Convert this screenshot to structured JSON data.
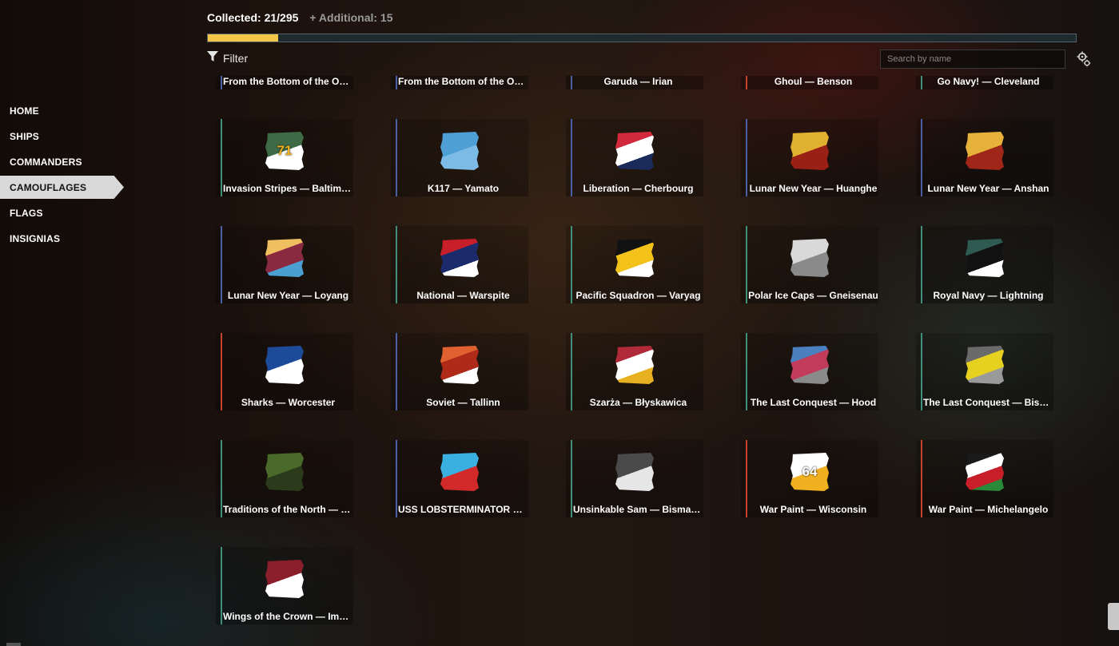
{
  "sidebar": {
    "items": [
      {
        "label": "HOME",
        "active": false
      },
      {
        "label": "SHIPS",
        "active": false
      },
      {
        "label": "COMMANDERS",
        "active": false
      },
      {
        "label": "CAMOUFLAGES",
        "active": true
      },
      {
        "label": "FLAGS",
        "active": false
      },
      {
        "label": "INSIGNIAS",
        "active": false
      }
    ]
  },
  "header": {
    "collected_label": "Collected: 21/295",
    "additional_label": "+ Additional: 15",
    "progress_fraction": 0.081
  },
  "filter": {
    "label": "Filter",
    "search_placeholder": "Search by name"
  },
  "colors": {
    "accent_yellow": "#f2c747",
    "accent_red": "#c8412c",
    "accent_blue": "#4a5fa6",
    "accent_teal": "#3f8f7a"
  },
  "grid": {
    "items": [
      {
        "label": "From the Bottom of the Ocea...",
        "accent": "#4a5fa6",
        "icon_colors": [
          "#1a2a44",
          "#2e5a88"
        ],
        "icon_text": ""
      },
      {
        "label": "From the Bottom of the Ocea...",
        "accent": "#4a5fa6",
        "icon_colors": [
          "#1a2a44",
          "#3c3c3c"
        ],
        "icon_text": ""
      },
      {
        "label": "Garuda — Irian",
        "accent": "#4a5fa6",
        "icon_colors": [
          "#7a1a2a",
          "#c23b3b"
        ],
        "icon_text": ""
      },
      {
        "label": "Ghoul — Benson",
        "accent": "#c8412c",
        "icon_colors": [
          "#5a1530",
          "#9b2a4a"
        ],
        "icon_text": ""
      },
      {
        "label": "Go Navy! — Cleveland",
        "accent": "#3f8f7a",
        "icon_colors": [
          "#1a2a6a",
          "#c2283a"
        ],
        "icon_text": ""
      },
      {
        "label": "Invasion Stripes — Baltimore",
        "accent": "#3f8f7a",
        "icon_colors": [
          "#3e6a45",
          "#ffffff"
        ],
        "icon_text": "71"
      },
      {
        "label": "K117 — Yamato",
        "accent": "#4a5fa6",
        "icon_colors": [
          "#4d9fd6",
          "#7cbbe6"
        ],
        "icon_text": ""
      },
      {
        "label": "Liberation — Cherbourg",
        "accent": "#4a5fa6",
        "icon_colors": [
          "#d22a3c",
          "#ffffff",
          "#1a2a5a"
        ],
        "icon_text": ""
      },
      {
        "label": "Lunar New Year — Huanghe",
        "accent": "#4a5fa6",
        "icon_colors": [
          "#e0b030",
          "#9a2016"
        ],
        "icon_text": ""
      },
      {
        "label": "Lunar New Year — Anshan",
        "accent": "#4a5fa6",
        "icon_colors": [
          "#e7b23a",
          "#a1261a"
        ],
        "icon_text": ""
      },
      {
        "label": "Lunar New Year — Loyang",
        "accent": "#4a5fa6",
        "icon_colors": [
          "#f0c060",
          "#8a2a40",
          "#4aa0d0"
        ],
        "icon_text": ""
      },
      {
        "label": "National — Warspite",
        "accent": "#3f8f7a",
        "icon_colors": [
          "#c81e2a",
          "#1a2a6a",
          "#ffffff"
        ],
        "icon_text": ""
      },
      {
        "label": "Pacific Squadron — Varyag",
        "accent": "#3f8f7a",
        "icon_colors": [
          "#111111",
          "#f2c21a",
          "#ffffff"
        ],
        "icon_text": ""
      },
      {
        "label": "Polar Ice Caps — Gneisenau",
        "accent": "#3f8f7a",
        "icon_colors": [
          "#d9d9d9",
          "#8a8a8a"
        ],
        "icon_text": ""
      },
      {
        "label": "Royal Navy — Lightning",
        "accent": "#3f8f7a",
        "icon_colors": [
          "#2e5a52",
          "#111111",
          "#ffffff"
        ],
        "icon_text": ""
      },
      {
        "label": "Sharks — Worcester",
        "accent": "#c8412c",
        "icon_colors": [
          "#1e4a9a",
          "#ffffff"
        ],
        "icon_text": ""
      },
      {
        "label": "Soviet — Tallinn",
        "accent": "#4a5fa6",
        "icon_colors": [
          "#e06030",
          "#b02a1a",
          "#ffffff"
        ],
        "icon_text": ""
      },
      {
        "label": "Szarża — Błyskawica",
        "accent": "#3f8f7a",
        "icon_colors": [
          "#b02a3a",
          "#ffffff",
          "#e6b020"
        ],
        "icon_text": ""
      },
      {
        "label": "The Last Conquest — Hood",
        "accent": "#3f8f7a",
        "icon_colors": [
          "#4a80c0",
          "#c23b5a",
          "#8a8a8a"
        ],
        "icon_text": ""
      },
      {
        "label": "The Last Conquest — Bismar...",
        "accent": "#3f8f7a",
        "icon_colors": [
          "#6a6a6a",
          "#e6d020",
          "#9a9a9a"
        ],
        "icon_text": ""
      },
      {
        "label": "Traditions of the North — Vä...",
        "accent": "#3f8f7a",
        "icon_colors": [
          "#4a6a2a",
          "#2a3a1a"
        ],
        "icon_text": ""
      },
      {
        "label": "USS LOBSTERMINATOR — N...",
        "accent": "#4a5fa6",
        "icon_colors": [
          "#3ab0e0",
          "#d22a2a"
        ],
        "icon_text": ""
      },
      {
        "label": "Unsinkable Sam — Bismarck",
        "accent": "#3f8f7a",
        "icon_colors": [
          "#4a4a4a",
          "#e6e6e6"
        ],
        "icon_text": ""
      },
      {
        "label": "War Paint — Wisconsin",
        "accent": "#c8412c",
        "icon_colors": [
          "#ffffff",
          "#f0b020"
        ],
        "icon_text": "64"
      },
      {
        "label": "War Paint — Michelangelo",
        "accent": "#c8412c",
        "icon_colors": [
          "#1a1a1a",
          "#ffffff",
          "#c81e2a",
          "#2a8a3a"
        ],
        "icon_text": ""
      },
      {
        "label": "Wings of the Crown — Impla...",
        "accent": "#3f8f7a",
        "icon_colors": [
          "#8a1e2a",
          "#ffffff"
        ],
        "icon_text": ""
      }
    ]
  }
}
